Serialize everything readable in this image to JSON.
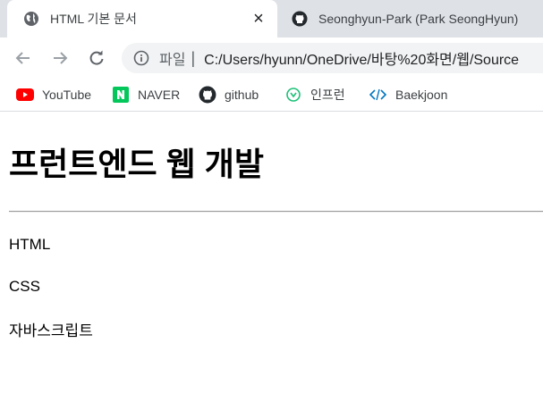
{
  "browser": {
    "tabs": [
      {
        "title": "HTML 기본 문서",
        "icon": "globe-icon",
        "active": true
      },
      {
        "title": "Seonghyun-Park (Park SeongHyun)",
        "icon": "github-icon",
        "active": false
      }
    ],
    "address_bar": {
      "scheme_label": "파일",
      "url": "C:/Users/hyunn/OneDrive/바탕%20화면/웹/Source"
    },
    "bookmarks": [
      {
        "label": "YouTube",
        "icon": "youtube-icon"
      },
      {
        "label": "NAVER",
        "icon": "naver-icon"
      },
      {
        "label": "github",
        "icon": "github-icon"
      },
      {
        "label": "인프런",
        "icon": "inflearn-icon"
      },
      {
        "label": "Baekjoon",
        "icon": "code-icon"
      }
    ]
  },
  "page": {
    "heading": "프런트엔드 웹 개발",
    "items": [
      "HTML",
      "CSS",
      "자바스크립트"
    ]
  },
  "colors": {
    "tabstrip": "#dee1e6",
    "omnibox": "#f1f3f4",
    "youtube": "#ff0000",
    "naver": "#03c75a",
    "inflearn": "#1dc078",
    "baekjoon": "#0076c0"
  }
}
